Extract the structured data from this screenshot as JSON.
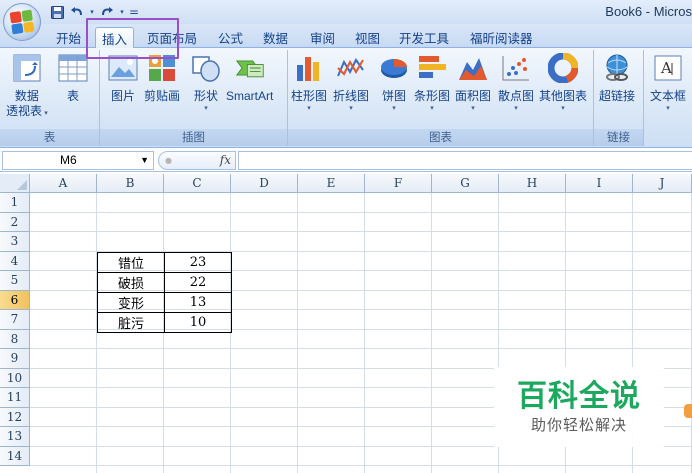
{
  "window": {
    "title": "Book6 - Micros"
  },
  "quick_access": {
    "save_icon": "save-icon",
    "undo_icon": "undo-icon",
    "redo_icon": "redo-icon",
    "customize_symbol": "="
  },
  "tabs": [
    {
      "label": "开始",
      "active": false
    },
    {
      "label": "插入",
      "active": true
    },
    {
      "label": "页面布局",
      "active": false
    },
    {
      "label": "公式",
      "active": false
    },
    {
      "label": "数据",
      "active": false
    },
    {
      "label": "审阅",
      "active": false
    },
    {
      "label": "视图",
      "active": false
    },
    {
      "label": "开发工具",
      "active": false
    },
    {
      "label": "福昕阅读器",
      "active": false
    }
  ],
  "ribbon": {
    "groups": {
      "table": {
        "label": "表",
        "buttons": [
          {
            "line1": "数据",
            "line2": "透视表"
          },
          {
            "line1": "表"
          }
        ]
      },
      "illustrations": {
        "label": "插图",
        "buttons": [
          {
            "label": "图片"
          },
          {
            "label": "剪贴画"
          },
          {
            "label": "形状"
          },
          {
            "label": "SmartArt"
          }
        ]
      },
      "charts": {
        "label": "图表",
        "buttons": [
          {
            "label": "柱形图"
          },
          {
            "label": "折线图"
          },
          {
            "label": "饼图"
          },
          {
            "label": "条形图"
          },
          {
            "label": "面积图"
          },
          {
            "label": "散点图"
          },
          {
            "label": "其他图表"
          }
        ]
      },
      "links": {
        "label": "链接",
        "buttons": [
          {
            "label": "超链接"
          }
        ]
      },
      "text": {
        "buttons": [
          {
            "label": "文本框"
          }
        ]
      }
    },
    "accent_color": "#9a4fc8"
  },
  "formula_bar": {
    "name_box": "M6",
    "fx_label": "fx",
    "formula": ""
  },
  "sheet": {
    "columns": [
      "A",
      "B",
      "C",
      "D",
      "E",
      "F",
      "G",
      "H",
      "I",
      "J"
    ],
    "rows": [
      "1",
      "2",
      "3",
      "4",
      "5",
      "6",
      "7",
      "8",
      "9",
      "10",
      "11",
      "12",
      "13",
      "14"
    ],
    "selected_row": "6",
    "data": [
      {
        "label": "错位",
        "value": "23"
      },
      {
        "label": "破损",
        "value": "22"
      },
      {
        "label": "变形",
        "value": "13"
      },
      {
        "label": "脏污",
        "value": "10"
      }
    ]
  },
  "watermark": {
    "title": "百科全说",
    "subtitle": "助你轻松解决",
    "color": "#1ca85d"
  }
}
